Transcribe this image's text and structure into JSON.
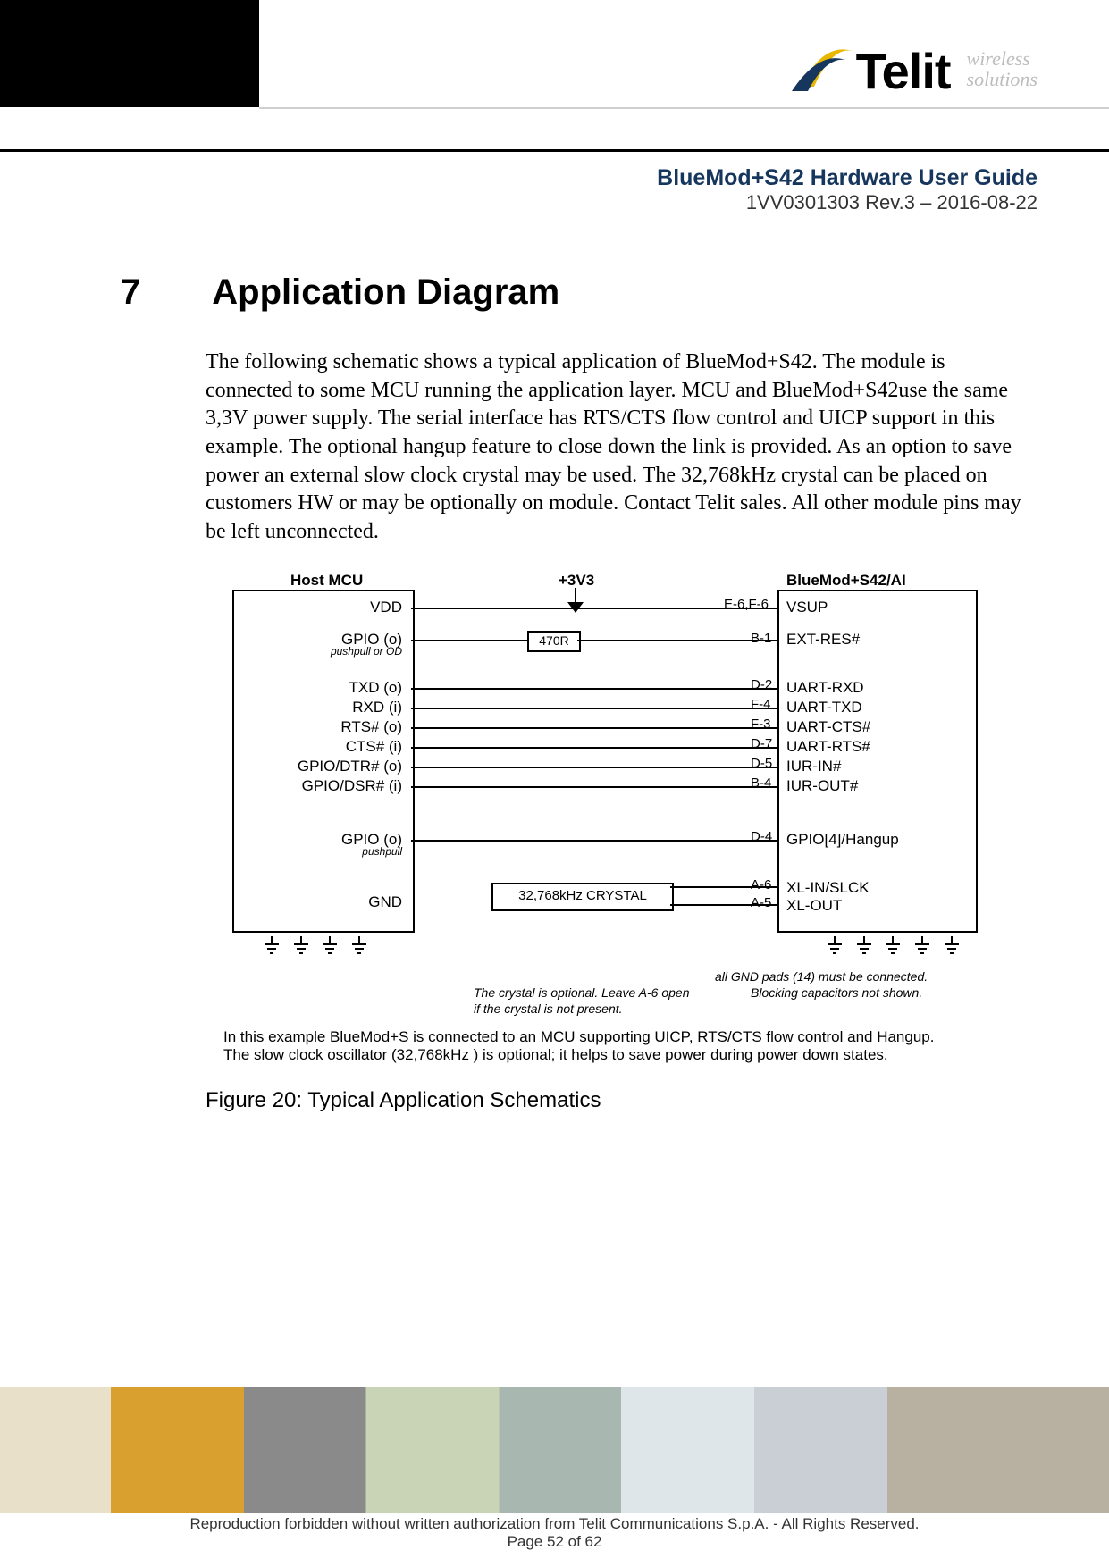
{
  "brand": {
    "name": "Telit",
    "sub1": "wireless",
    "sub2": "solutions"
  },
  "doc": {
    "title": "BlueMod+S42 Hardware User Guide",
    "rev": "1VV0301303 Rev.3 – 2016-08-22"
  },
  "section": {
    "num": "7",
    "title": "Application Diagram"
  },
  "paragraph": "The following schematic shows a typical application of BlueMod+S42. The module is connected to some MCU running the application layer. MCU and BlueMod+S42use the same 3,3V power supply. The serial interface has RTS/CTS flow control and UICP support in this example. The optional hangup feature to close down the link is provided. As an option to save power an external slow clock crystal may be used. The 32,768kHz crystal can be placed on customers HW or may be optionally on module. Contact Telit sales. All other module pins may be left unconnected.",
  "schematic": {
    "host_title": "Host MCU",
    "module_title": "BlueMod+S42/AI",
    "supply": "+3V3",
    "resistor": "470R",
    "crystal": "32,768kHz CRYSTAL",
    "host_pins": [
      {
        "label": "VDD",
        "note": ""
      },
      {
        "label": "GPIO (o)",
        "note": "pushpull or OD"
      },
      {
        "label": "TXD (o)",
        "note": ""
      },
      {
        "label": "RXD (i)",
        "note": ""
      },
      {
        "label": "RTS# (o)",
        "note": ""
      },
      {
        "label": "CTS# (i)",
        "note": ""
      },
      {
        "label": "GPIO/DTR# (o)",
        "note": ""
      },
      {
        "label": "GPIO/DSR# (i)",
        "note": ""
      },
      {
        "label": "GPIO (o)",
        "note": "pushpull"
      },
      {
        "label": "GND",
        "note": ""
      }
    ],
    "mod_pins": [
      {
        "pad": "E-6,F-6",
        "label": "VSUP"
      },
      {
        "pad": "B-1",
        "label": "EXT-RES#"
      },
      {
        "pad": "D-2",
        "label": "UART-RXD"
      },
      {
        "pad": "F-4",
        "label": "UART-TXD"
      },
      {
        "pad": "F-3",
        "label": "UART-CTS#"
      },
      {
        "pad": "D-7",
        "label": "UART-RTS#"
      },
      {
        "pad": "D-5",
        "label": "IUR-IN#"
      },
      {
        "pad": "B-4",
        "label": "IUR-OUT#"
      },
      {
        "pad": "D-4",
        "label": "GPIO[4]/Hangup"
      },
      {
        "pad": "A-6",
        "label": "XL-IN/SLCK"
      },
      {
        "pad": "A-5",
        "label": "XL-OUT"
      }
    ],
    "note_gnd": "all GND pads (14) must be connected.",
    "note_block": "Blocking capacitors not shown.",
    "note_crystal1": "The crystal is optional. Leave A-6 open",
    "note_crystal2": "if the crystal is not present.",
    "ex1": "In this example BlueMod+S is connected to an MCU supporting UICP, RTS/CTS flow control and Hangup.",
    "ex2": "The slow clock oscillator (32,768kHz ) is optional; it helps to save power during power down states."
  },
  "figure_caption": "Figure 20: Typical Application Schematics",
  "footer": {
    "line1": "Reproduction forbidden without written authorization from Telit Communications S.p.A. - All Rights Reserved.",
    "line2": "Page 52 of 62"
  }
}
